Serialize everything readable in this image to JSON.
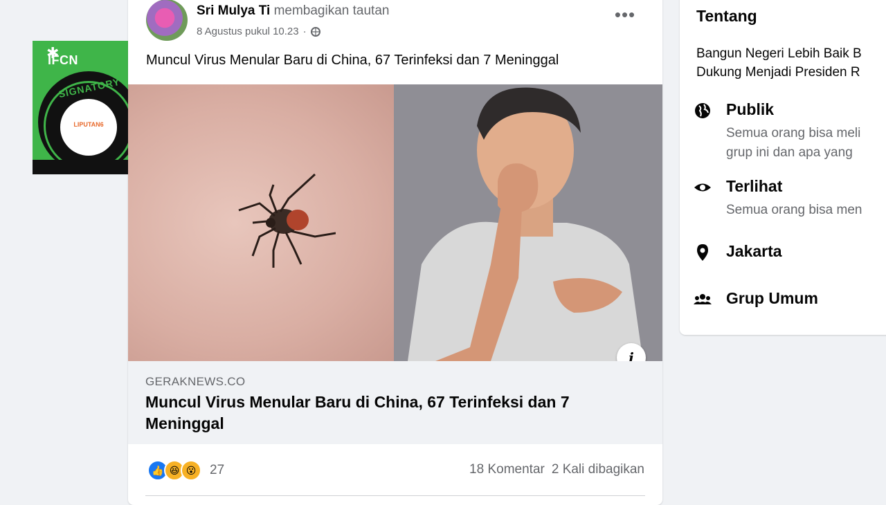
{
  "badge": {
    "top_text": "IFCN",
    "ring_text": "SIGNATORY",
    "center_text": "LIPUTAN6"
  },
  "post": {
    "author_name": "Sri Mulya Ti",
    "action": "membagikan tautan",
    "timestamp": "8 Agustus pukul 10.23",
    "more_icon": "more-icon",
    "text": "Muncul Virus Menular Baru di China, 67 Terinfeksi dan 7 Meninggal",
    "link": {
      "domain": "GERAKNEWS.CO",
      "title": "Muncul Virus Menular Baru di China, 67 Terinfeksi dan 7 Meninggal",
      "info_label": "i"
    },
    "reactions": {
      "icons": [
        "like-icon",
        "haha-icon",
        "wow-icon"
      ],
      "count": "27"
    },
    "comments": "18 Komentar",
    "shares": "2 Kali dibagikan"
  },
  "about": {
    "title": "Tentang",
    "desc_line1": "Bangun Negeri Lebih Baik B",
    "desc_line2": "Dukung Menjadi Presiden R",
    "items": [
      {
        "icon": "globe-icon",
        "label": "Publik",
        "sub1": "Semua orang bisa meli",
        "sub2": "grup ini dan apa yang"
      },
      {
        "icon": "eye-icon",
        "label": "Terlihat",
        "sub1": "Semua orang bisa men"
      },
      {
        "icon": "location-pin-icon",
        "label": "Jakarta"
      },
      {
        "icon": "group-icon",
        "label": "Grup Umum"
      }
    ]
  },
  "colors": {
    "background": "#f0f2f5",
    "secondary_text": "#65676b",
    "like_blue": "#1877f2",
    "badge_green": "#3fb549"
  }
}
